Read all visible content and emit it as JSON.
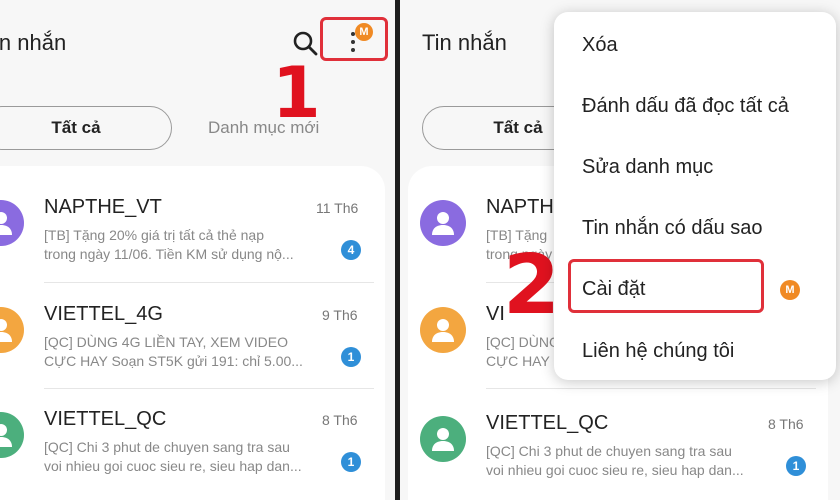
{
  "app_title_left": "in nhắn",
  "app_title_right": "Tin nhắn",
  "step1": "1",
  "step2": "2",
  "avatar_badge": "M",
  "tabs": {
    "all": "Tất cả",
    "new_category": "Danh mục mới"
  },
  "messages": [
    {
      "sender": "NAPTHE_VT",
      "date": "11 Th6",
      "line1": "[TB] Tặng 20% giá trị tất cả thẻ nạp",
      "line2": "trong ngày 11/06. Tiền KM sử dụng nộ...",
      "count": "4",
      "avatar_color": "#8a6be0"
    },
    {
      "sender": "VIETTEL_4G",
      "date": "9 Th6",
      "line1": "[QC] DÙNG 4G LIỀN TAY, XEM VIDEO",
      "line2": "CỰC HAY Soạn ST5K gửi 191: chỉ 5.00...",
      "count": "1",
      "avatar_color": "#f3a640"
    },
    {
      "sender": "VIETTEL_QC",
      "date": "8 Th6",
      "line1": "[QC] Chi 3 phut de chuyen sang tra sau",
      "line2": "voi nhieu goi cuoc sieu re, sieu hap dan...",
      "count": "1",
      "avatar_color": "#4caf7d"
    }
  ],
  "right_partial": {
    "sender1": "NAPTHE",
    "sender2": "VI",
    "line_tb": "[TB] Tặng",
    "line_trong": "trong ngày",
    "line_qc": "[QC] DÙNG",
    "line_cuc": "CỰC HAY"
  },
  "menu": {
    "items": [
      "Xóa",
      "Đánh dấu đã đọc tất cả",
      "Sửa danh mục",
      "Tin nhắn có dấu sao",
      "Cài đặt",
      "Liên hệ chúng tôi"
    ]
  },
  "colors": {
    "highlight": "#e0303a",
    "step_number": "#e0121f",
    "badge_orange": "#f08a24",
    "count_blue": "#2f8fd8"
  }
}
